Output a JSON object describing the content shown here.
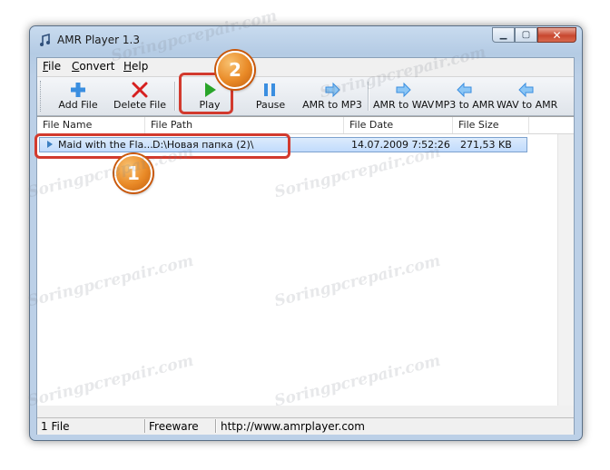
{
  "window": {
    "title": "AMR Player 1.3"
  },
  "menu": [
    {
      "label_rest": "ile",
      "accel": "F"
    },
    {
      "label_rest": "onvert",
      "accel": "C"
    },
    {
      "label_rest": "elp",
      "accel": "H"
    }
  ],
  "toolbar": {
    "add_file": "Add File",
    "delete_file": "Delete File",
    "play": "Play",
    "pause": "Pause",
    "amr_to_mp3": "AMR to MP3",
    "amr_to_wav": "AMR to WAV",
    "mp3_to_amr": "MP3 to AMR",
    "wav_to_amr": "WAV to AMR"
  },
  "list": {
    "columns": [
      "File Name",
      "File Path",
      "File Date",
      "File Size"
    ],
    "rows": [
      {
        "name": "Maid with the Fla...",
        "path": "D:\\Новая папка (2)\\",
        "date": "14.07.2009 7:52:26",
        "size": "271,53 KB"
      }
    ]
  },
  "status": {
    "count": "1 File",
    "license": "Freeware",
    "url": "http://www.amrplayer.com"
  },
  "annotations": {
    "badge1": "1",
    "badge2": "2"
  },
  "watermark": "Soringpcrepair.com",
  "colors": {
    "highlight": "#d23a2e",
    "badge": "#e98a27",
    "play_green": "#2aa52a",
    "arrow_blue": "#3a8ee0",
    "delete_red": "#d62020"
  }
}
